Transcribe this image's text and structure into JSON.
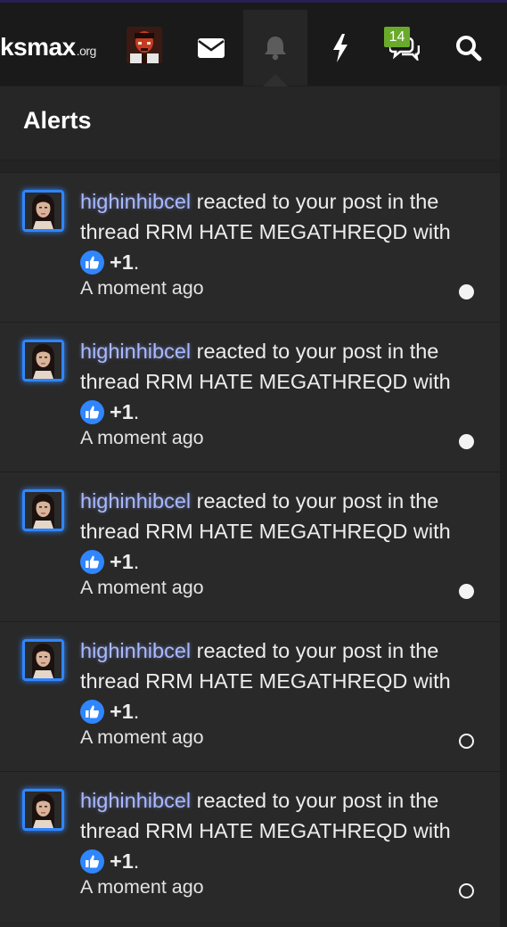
{
  "header": {
    "logo_text": "ksmax",
    "logo_suffix": ".org",
    "notification_badge": "14",
    "icons": [
      "envelope-icon",
      "bell-icon",
      "bolt-icon",
      "conversations-icon",
      "search-icon"
    ]
  },
  "panel": {
    "title": "Alerts"
  },
  "alerts": [
    {
      "username": "highinhibcel",
      "action": "reacted to your post in the thread RRM HATE MEGATHREQD with",
      "reaction": "+1",
      "time": "A moment ago",
      "unread": true
    },
    {
      "username": "highinhibcel",
      "action": "reacted to your post in the thread RRM HATE MEGATHREQD with",
      "reaction": "+1",
      "time": "A moment ago",
      "unread": true
    },
    {
      "username": "highinhibcel",
      "action": "reacted to your post in the thread RRM HATE MEGATHREQD with",
      "reaction": "+1",
      "time": "A moment ago",
      "unread": true
    },
    {
      "username": "highinhibcel",
      "action": "reacted to your post in the thread RRM HATE MEGATHREQD with",
      "reaction": "+1",
      "time": "A moment ago",
      "unread": false
    },
    {
      "username": "highinhibcel",
      "action": "reacted to your post in the thread RRM HATE MEGATHREQD with",
      "reaction": "+1",
      "time": "A moment ago",
      "unread": false
    }
  ],
  "colors": {
    "accent": "#2f86ff",
    "badge": "#6aaa2a",
    "username": "#a9b9ff",
    "background": "#262626"
  }
}
